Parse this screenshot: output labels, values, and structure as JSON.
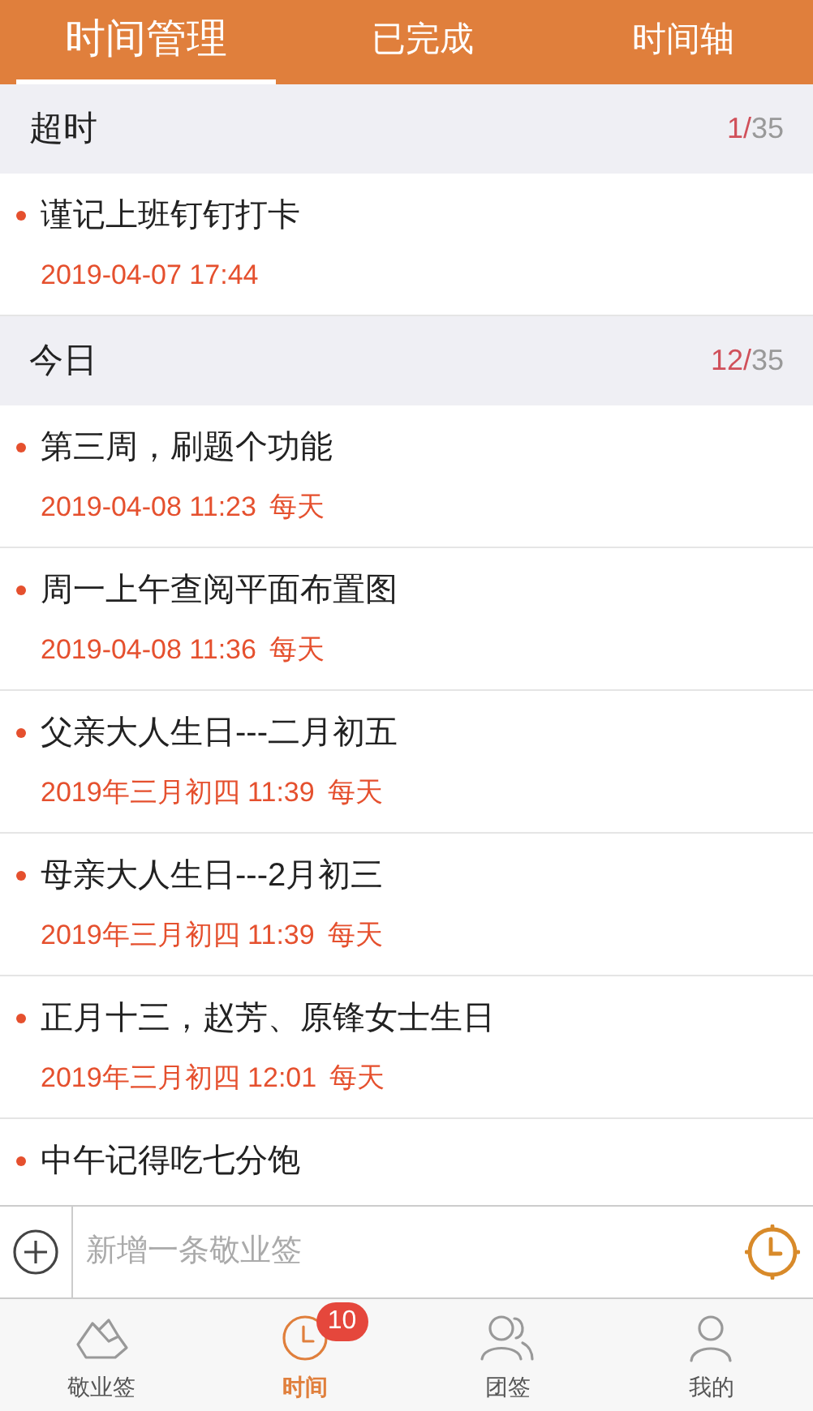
{
  "tabs": [
    {
      "label": "时间管理",
      "selected": true
    },
    {
      "label": "已完成",
      "selected": false
    },
    {
      "label": "时间轴",
      "selected": false
    }
  ],
  "sections": [
    {
      "title": "超时",
      "count": "1/",
      "total": "35",
      "items": [
        {
          "title": "谨记上班钉钉打卡",
          "date": "2019-04-07 17:44"
        }
      ]
    },
    {
      "title": "今日",
      "count": "12/",
      "total": "35",
      "items": [
        {
          "title": "第三周，刷题个功能",
          "date": "2019-04-08 11:23",
          "repeat": "每天"
        },
        {
          "title": "周一上午查阅平面布置图",
          "date": "2019-04-08 11:36",
          "repeat": "每天"
        },
        {
          "title": "父亲大人生日---二月初五",
          "date": "2019年三月初四 11:39",
          "repeat": "每天"
        },
        {
          "title": "母亲大人生日---2月初三",
          "date": "2019年三月初四 11:39",
          "repeat": "每天"
        },
        {
          "title": "正月十三，赵芳、原锋女士生日",
          "date": "2019年三月初四 12:01",
          "repeat": "每天"
        },
        {
          "title": "中午记得吃七分饱"
        }
      ]
    }
  ],
  "input": {
    "placeholder": "新增一条敬业签"
  },
  "nav": [
    {
      "label": "敬业签",
      "kind": "note",
      "selected": false
    },
    {
      "label": "时间",
      "kind": "clock",
      "selected": true,
      "badge": "10"
    },
    {
      "label": "团签",
      "kind": "team",
      "selected": false
    },
    {
      "label": "我的",
      "kind": "user",
      "selected": false
    }
  ]
}
